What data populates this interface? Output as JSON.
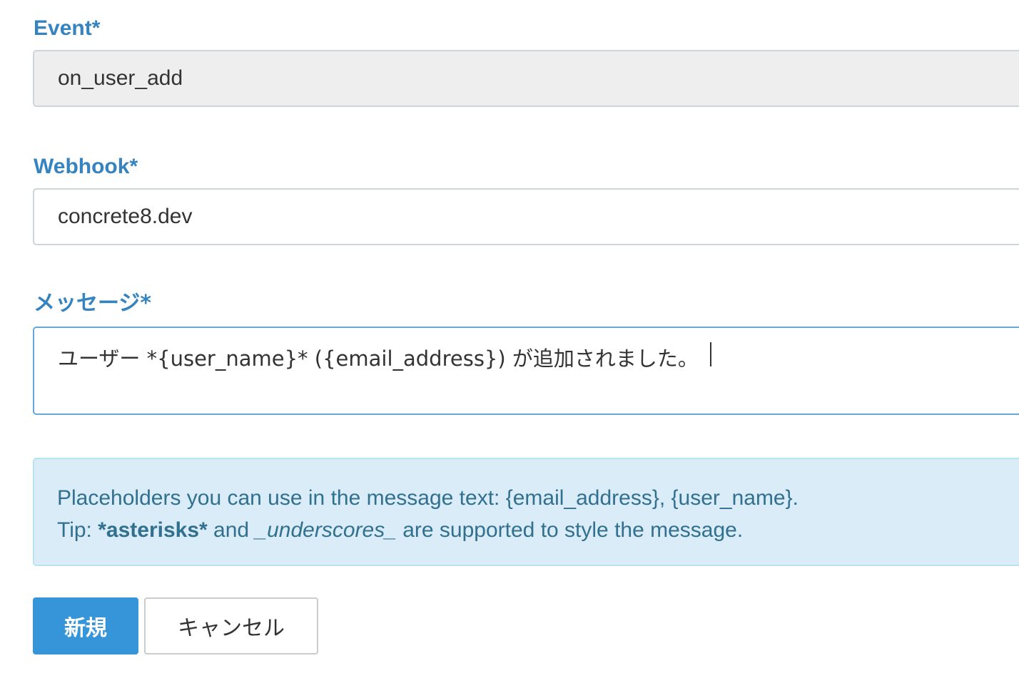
{
  "form": {
    "event": {
      "label": "Event*",
      "value": "on_user_add"
    },
    "webhook": {
      "label": "Webhook*",
      "value": "concrete8.dev"
    },
    "message": {
      "label": "メッセージ*",
      "value": "ユーザー *{user_name}* ({email_address}) が追加されました。"
    }
  },
  "info": {
    "line1": "Placeholders you can use in the message text: {email_address}, {user_name}.",
    "tip_prefix": "Tip: ",
    "tip_bold": "*asterisks*",
    "tip_and": " and ",
    "tip_italic": "_underscores_",
    "tip_suffix": " are supported to style the message."
  },
  "buttons": {
    "submit": "新規",
    "cancel": "キャンセル"
  },
  "colors": {
    "label": "#3583bf",
    "primary": "#3595d8",
    "info_bg": "#d9ecf7",
    "info_text": "#31708f"
  }
}
